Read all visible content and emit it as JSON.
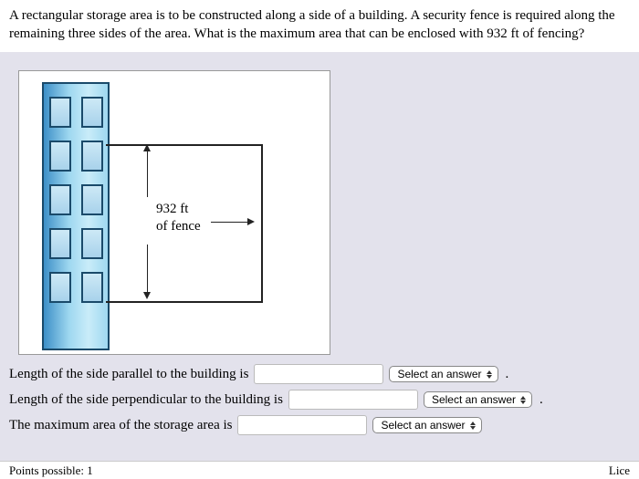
{
  "question": "A rectangular storage area is to be constructed along a side of a building. A security fence is required along the remaining three sides of the area. What is the maximum area that can be enclosed with 932 ft of fencing?",
  "diagram": {
    "fence_label_line1": "932 ft",
    "fence_label_line2": "of fence"
  },
  "answers": {
    "line1_text": "Length of the side parallel to the building is",
    "line2_text": "Length of the side perpendicular to the building is",
    "line3_text": "The maximum area of the storage area is",
    "select_label": "Select an answer",
    "period": "."
  },
  "footer": {
    "points": "Points possible: 1",
    "license": "Lice"
  }
}
